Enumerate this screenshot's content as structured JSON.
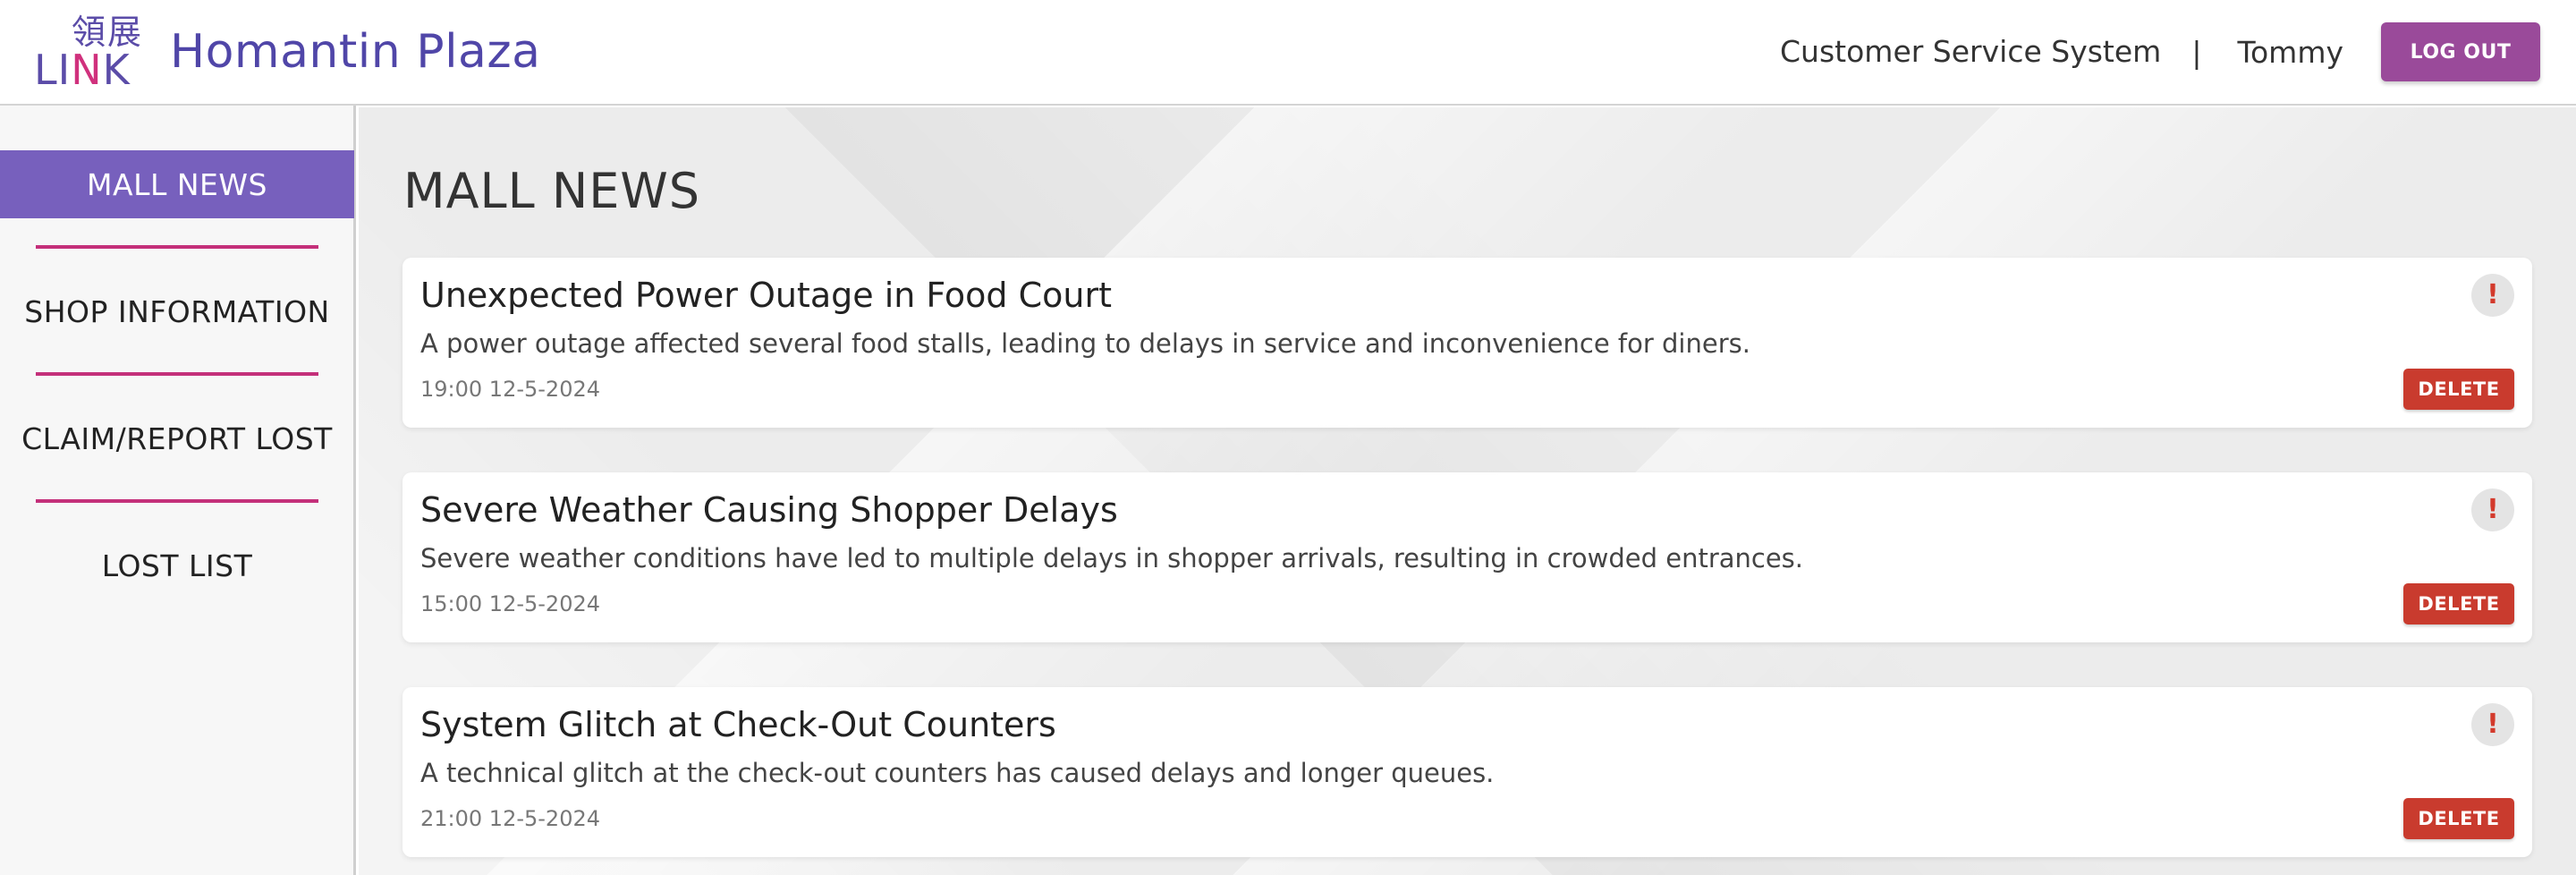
{
  "header": {
    "logo_cjk": "領展",
    "logo_word_a": "LI",
    "logo_word_b": "N",
    "logo_word_c": "K",
    "site_title": "Homantin Plaza",
    "system_name": "Customer Service System",
    "separator": "|",
    "user_name": "Tommy",
    "logout_label": "LOG OUT"
  },
  "sidebar": {
    "items": [
      {
        "label": "MALL NEWS",
        "active": true
      },
      {
        "label": "SHOP INFORMATION",
        "active": false
      },
      {
        "label": "CLAIM/REPORT LOST",
        "active": false
      },
      {
        "label": "LOST LIST",
        "active": false
      }
    ]
  },
  "main": {
    "title": "MALL NEWS",
    "news": [
      {
        "title": "Unexpected Power Outage in Food Court",
        "description": "A power outage affected several food stalls, leading to delays in service and inconvenience for diners.",
        "time": "19:00 12-5-2024",
        "alert_icon": "!",
        "delete_label": "DELETE"
      },
      {
        "title": "Severe Weather Causing Shopper Delays",
        "description": "Severe weather conditions have led to multiple delays in shopper arrivals, resulting in crowded entrances.",
        "time": "15:00 12-5-2024",
        "alert_icon": "!",
        "delete_label": "DELETE"
      },
      {
        "title": "System Glitch at Check-Out Counters",
        "description": "A technical glitch at the check-out counters has caused delays and longer queues.",
        "time": "21:00 12-5-2024",
        "alert_icon": "!",
        "delete_label": "DELETE"
      }
    ]
  },
  "colors": {
    "brand_purple": "#5b4ca8",
    "brand_magenta": "#d0317d",
    "logout_bg": "#9a4a9a",
    "nav_active_bg": "#7760bd",
    "nav_divider": "#c4307a",
    "delete_bg": "#c93b2e",
    "alert_red": "#d33a2c"
  }
}
